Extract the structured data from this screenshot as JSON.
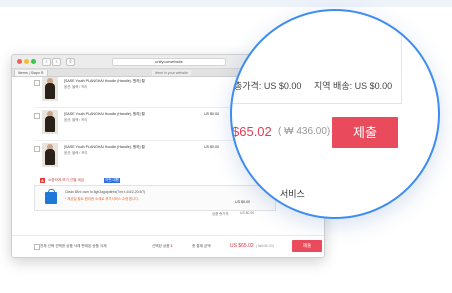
{
  "browser": {
    "url": "unifyourwebsite",
    "tabs": [
      "Ittems | Siapo R",
      "Ittem in your website"
    ]
  },
  "cart": {
    "items": [
      {
        "title": "[SASE Youth PLANGHAI Hoodie (Handle), 원하] 월",
        "option": "옵션: 블랙 / 프리",
        "price": "US $0.00"
      },
      {
        "title": "[SASE Youth PLANGHAI Hoodie (Handle), 원하] 월",
        "option": "옵션: 블랙 / 프리",
        "price": "US $0.00"
      },
      {
        "title": "[SASE Youth PLANGHAI Hoodie (Handle), 원하] 월",
        "option": "옵션: 블랙 / 프리",
        "price": "US $0.00"
      }
    ],
    "section_tag": "A",
    "section_title": "소중하게 보기 선별 세금",
    "section_badge": "어떤 대행"
  },
  "service": {
    "line1": "Clean 88rt: osm fo 8gh3agdpdtrek(7/m:t-4/4/2-20:5/7)",
    "line2": "* 제공일 필요 원리한 소재로 부가서비스 수령 합니다.",
    "price": "US $0.00"
  },
  "summary": {
    "shipping": "상품 총가격",
    "shipping_value": "US $0.00"
  },
  "footer": {
    "select_all": "전체 선택   선택한 상품 삭제   판매된 상품 삭제",
    "count_label": "선택된 상품",
    "count": "2",
    "total_label": "총 결제 금액:",
    "total": "US $65.02",
    "total_krw": "( ₩436.00)",
    "submit": "제출"
  },
  "magnifier": {
    "product_total": "총가격:  US $0.00",
    "shipping": "지역 배송:  US $0.00",
    "total": "$65.02",
    "total_krw": "( ₩ 436.00)",
    "submit": "제출",
    "service": "서비스"
  },
  "colors": {
    "accent": "#e94b5d",
    "price_red": "#e0304a",
    "ring": "#3d8df0",
    "service_icon": "#1f78d8"
  }
}
